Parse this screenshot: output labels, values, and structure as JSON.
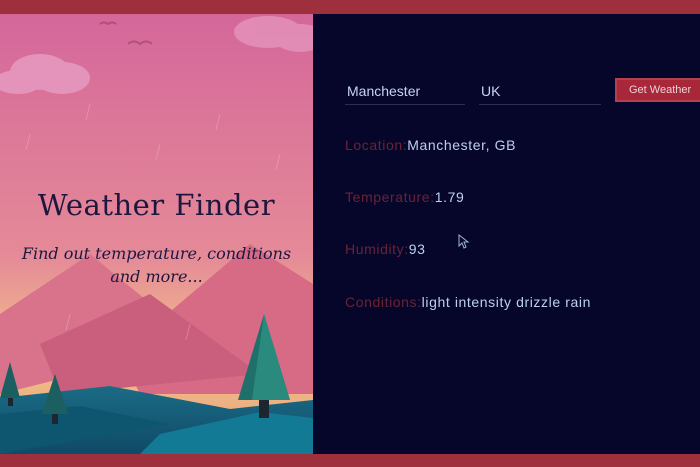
{
  "app": {
    "title": "Weather Finder",
    "subtitle": "Find out temperature, conditions and more..."
  },
  "form": {
    "city_value": "Manchester",
    "country_value": "UK",
    "button_label": "Get Weather"
  },
  "results": [
    {
      "label": "Location:",
      "value": "Manchester, GB"
    },
    {
      "label": "Temperature:",
      "value": "1.79"
    },
    {
      "label": "Humidity:",
      "value": "93"
    },
    {
      "label": "Conditions:",
      "value": "light intensity drizzle rain"
    }
  ],
  "colors": {
    "panel_background": "#06062a",
    "button": "#a8283a",
    "label": "#6b2235",
    "value": "#bcd0f0",
    "sky_top": "#d46a94",
    "sky_bottom": "#f0c48a"
  },
  "icons": [
    "cloud-icon",
    "bird-icon",
    "mountain-icon",
    "pine-tree-icon",
    "mouse-cursor-icon"
  ]
}
